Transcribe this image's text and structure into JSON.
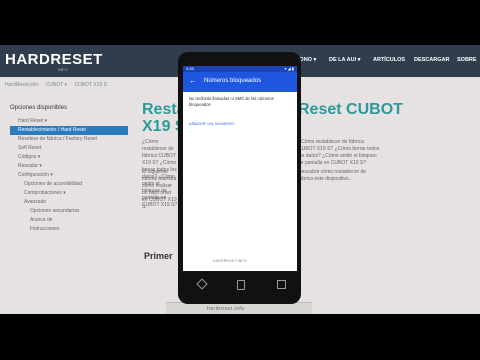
{
  "site": {
    "logo": "HARDRESET",
    "logo_sub": "INFO",
    "nav": [
      "TÉLÉFONO ▾",
      "DE LA AUI ▾",
      "ARTÍCULOS",
      "DESCARGAR",
      "SOBRE"
    ],
    "breadcrumbs": [
      "HardReset.info",
      "CUBOT ▾",
      "CUBOT X19 S"
    ]
  },
  "sidebar": {
    "title": "Opciones disponibles",
    "items": [
      "Hard Reset ▾",
      "Restablecimiento / Hard Reset",
      "Resetear de fábrica / Factory Reset",
      "Soft Reset",
      "Códigos ▾",
      "Rescatar ▾",
      "Configuración ▾",
      "Opciones de accesibilidad",
      "Comprobaciones ▾",
      "Avanzado",
      "Opciones secundarias",
      "Acerca de",
      "Instrucciones"
    ]
  },
  "article": {
    "title_left": "Resta",
    "title_left_line2": "X19 S",
    "title_right": "Reset CUBOT",
    "h2": "Primer",
    "para1": "¿Cómo restablecer de fábrica CUBOT X19 S? ¿Cómo borrar todos los datos? ¿Cómo omitir el bloqueo de pantalla en CUBOT X19 S?",
    "para2": "El siguiente tutorial muestra cómo realizar un hard reset en CUBOT X19 S.",
    "para3": "Descubre cómo restablecer de fábrica este dispositivo..."
  },
  "phone": {
    "status_time": "3:28",
    "status_icons": "▾ ◢ ▮",
    "appbar_title": "Números bloqueados",
    "description": "No recibirás llamadas ni SMS de los números bloqueados",
    "add_link": "AÑADIR UN NÚMERO",
    "watermark": "HARDRESET.INFO",
    "stand_label": "hardreset.info"
  }
}
